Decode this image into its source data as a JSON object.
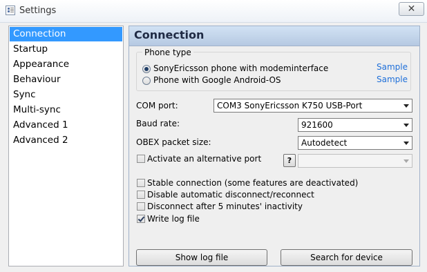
{
  "window": {
    "title": "Settings",
    "close_glyph": "✕",
    "icon": "settings-app-icon"
  },
  "nav": {
    "items": [
      "Connection",
      "Startup",
      "Appearance",
      "Behaviour",
      "Sync",
      "Multi-sync",
      "Advanced 1",
      "Advanced 2"
    ],
    "selected_index": 0
  },
  "panel": {
    "title": "Connection",
    "phone_type": {
      "legend": "Phone type",
      "options": [
        {
          "label": "SonyEricsson phone with modeminterface",
          "checked": true,
          "sample_link": "Sample"
        },
        {
          "label": "Phone with Google Android-OS",
          "checked": false,
          "sample_link": "Sample"
        }
      ]
    },
    "com_port": {
      "label": "COM port:",
      "value": "COM3 SonyEricsson K750 USB-Port"
    },
    "baud_rate": {
      "label": "Baud rate:",
      "value": "921600"
    },
    "obex": {
      "label": "OBEX packet size:",
      "value": "Autodetect"
    },
    "alt_port": {
      "label": "Activate an alternative port",
      "checked": false,
      "help": "?",
      "value": ""
    },
    "options": [
      {
        "label": "Stable connection (some features are deactivated)",
        "checked": false
      },
      {
        "label": "Disable automatic disconnect/reconnect",
        "checked": false
      },
      {
        "label": "Disconnect after 5 minutes' inactivity",
        "checked": false
      },
      {
        "label": "Write log file",
        "checked": true
      }
    ],
    "buttons": {
      "show_log": "Show log file",
      "search": "Search for device"
    }
  },
  "colors": {
    "accent": "#3399ff",
    "link": "#1e6fd9",
    "header": "#c4d6ec"
  }
}
